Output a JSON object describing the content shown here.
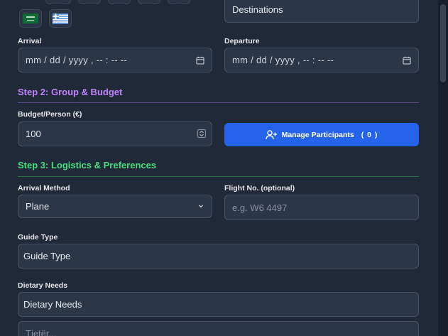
{
  "destinations": {
    "value": "Destinations"
  },
  "arrival": {
    "label": "Arrival",
    "value": "mm / dd / yyyy ,  -- : --   --"
  },
  "departure": {
    "label": "Departure",
    "value": "mm / dd / yyyy ,  -- : --   --"
  },
  "step2": {
    "title": "Step 2: Group & Budget",
    "color": "#c084fc"
  },
  "budget": {
    "label": "Budget/Person (€)",
    "value": "100"
  },
  "participants": {
    "label": "Manage Participants",
    "count": "( 0 )"
  },
  "step3": {
    "title": "Step 3: Logistics & Preferences",
    "color": "#4ade80"
  },
  "arrival_method": {
    "label": "Arrival Method",
    "value": "Plane"
  },
  "flight": {
    "label": "Flight No. (optional)",
    "placeholder": "e.g. W6 4497"
  },
  "guide": {
    "label": "Guide Type",
    "value": "Guide Type"
  },
  "dietary": {
    "label": "Dietary Needs",
    "value": "Dietary Needs"
  },
  "partial_field": {
    "placeholder": "Tjetër..."
  },
  "flags": {
    "left_icon": "saudi-arabia-flag-icon",
    "right_icon": "greece-flag-icon"
  }
}
